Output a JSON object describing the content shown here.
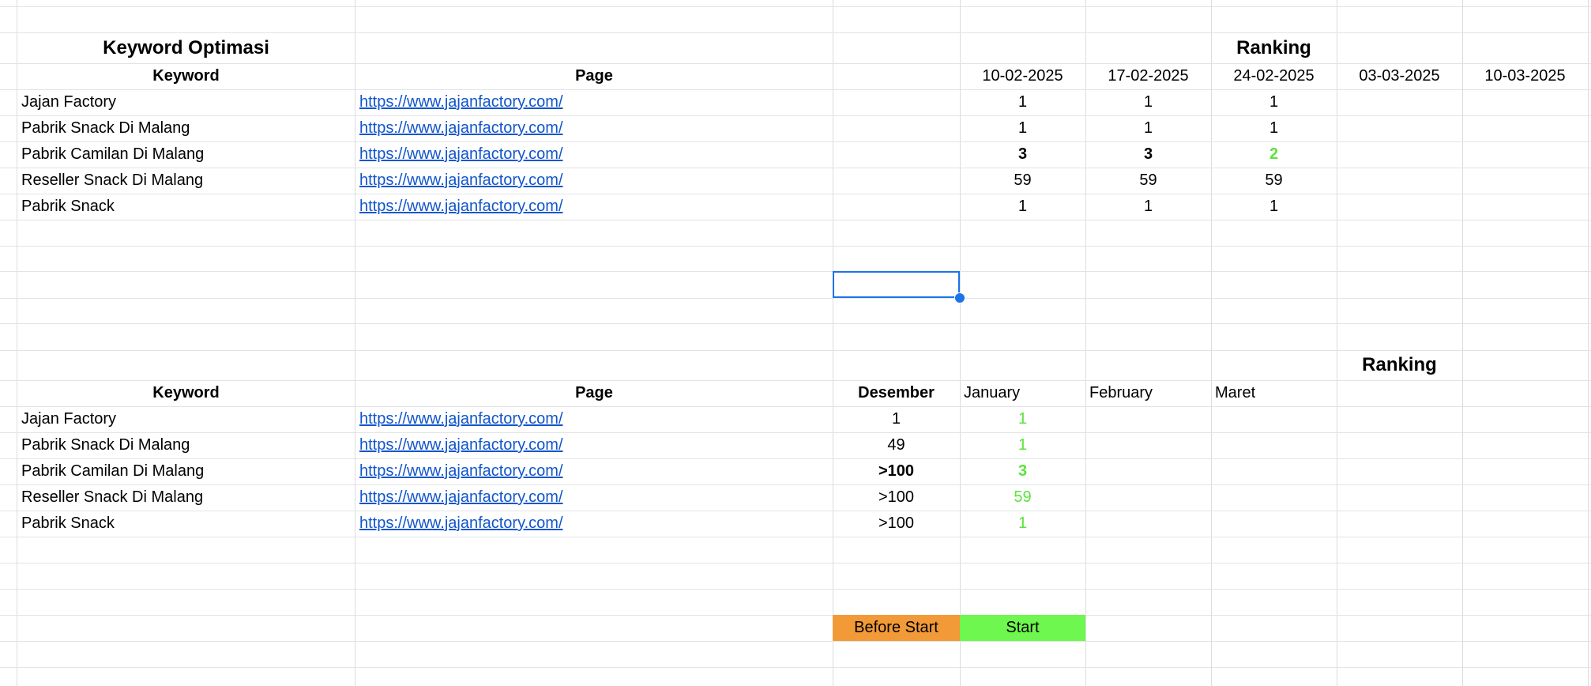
{
  "table1": {
    "title": "Keyword Optimasi",
    "ranking_title": "Ranking",
    "headers": {
      "keyword": "Keyword",
      "page": "Page"
    },
    "dates": [
      "10-02-2025",
      "17-02-2025",
      "24-02-2025",
      "03-03-2025",
      "10-03-2025"
    ],
    "rows": [
      {
        "keyword": "Jajan Factory",
        "page": "https://www.jajanfactory.com/",
        "ranks": [
          "1",
          "1",
          "1"
        ]
      },
      {
        "keyword": "Pabrik Snack Di Malang",
        "page": "https://www.jajanfactory.com/",
        "ranks": [
          "1",
          "1",
          "1"
        ]
      },
      {
        "keyword": "Pabrik Camilan Di Malang",
        "page": "https://www.jajanfactory.com/",
        "ranks": [
          "3",
          "3",
          "2"
        ]
      },
      {
        "keyword": "Reseller Snack Di Malang",
        "page": "https://www.jajanfactory.com/",
        "ranks": [
          "59",
          "59",
          "59"
        ]
      },
      {
        "keyword": "Pabrik Snack",
        "page": "https://www.jajanfactory.com/",
        "ranks": [
          "1",
          "1",
          "1"
        ]
      }
    ]
  },
  "table2": {
    "ranking_title": "Ranking",
    "headers": {
      "keyword": "Keyword",
      "page": "Page",
      "before": "Desember"
    },
    "months": [
      "January",
      "February",
      "Maret"
    ],
    "rows": [
      {
        "keyword": "Jajan Factory",
        "page": "https://www.jajanfactory.com/",
        "before": "1",
        "january": "1"
      },
      {
        "keyword": "Pabrik Snack Di Malang",
        "page": "https://www.jajanfactory.com/",
        "before": "49",
        "january": "1"
      },
      {
        "keyword": "Pabrik Camilan Di Malang",
        "page": "https://www.jajanfactory.com/",
        "before": ">100",
        "january": "3"
      },
      {
        "keyword": "Reseller Snack Di Malang",
        "page": "https://www.jajanfactory.com/",
        "before": ">100",
        "january": "59"
      },
      {
        "keyword": "Pabrik Snack",
        "page": "https://www.jajanfactory.com/",
        "before": ">100",
        "january": "1"
      }
    ]
  },
  "legend": {
    "before_start": {
      "label": "Before Start",
      "color": "#f29a38"
    },
    "start": {
      "label": "Start",
      "color": "#6ef74e"
    }
  },
  "colors": {
    "link": "#1155cc",
    "improved": "#5be33c",
    "selection": "#1a73e8"
  }
}
